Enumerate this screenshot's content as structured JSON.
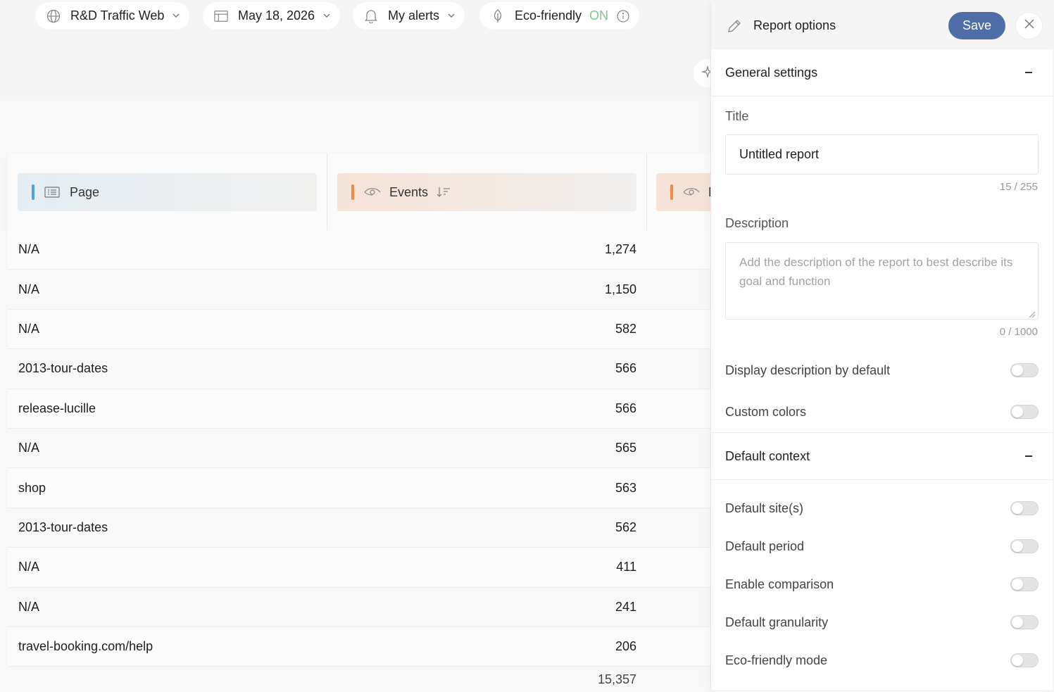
{
  "topbar": {
    "site": {
      "label": "R&D Traffic Web",
      "icon": "globe-icon"
    },
    "date": {
      "label": "May 18, 2026",
      "icon": "calendar-icon"
    },
    "alerts": {
      "label": "My alerts",
      "icon": "bell-icon"
    },
    "eco": {
      "label": "Eco-friendly",
      "status": "ON",
      "status_color": "#7fc88b",
      "icon": "leaf-icon"
    }
  },
  "table": {
    "columns": [
      {
        "label": "Page",
        "icon": "list-icon",
        "accent": "#4aa3e8"
      },
      {
        "label": "Events",
        "icon": "eye-icon",
        "accent": "#f08a4b"
      },
      {
        "label": "F",
        "icon": "eye-icon",
        "accent": "#f08a4b"
      }
    ],
    "rows": [
      {
        "page": "N/A",
        "events": "1,274"
      },
      {
        "page": "N/A",
        "events": "1,150"
      },
      {
        "page": "N/A",
        "events": "582"
      },
      {
        "page": "2013-tour-dates",
        "events": "566"
      },
      {
        "page": "release-lucille",
        "events": "566"
      },
      {
        "page": "N/A",
        "events": "565"
      },
      {
        "page": "shop",
        "events": "563"
      },
      {
        "page": "2013-tour-dates",
        "events": "562"
      },
      {
        "page": "N/A",
        "events": "411"
      },
      {
        "page": "N/A",
        "events": "241"
      },
      {
        "page": "travel-booking.com/help",
        "events": "206"
      }
    ],
    "total": "15,357"
  },
  "panel": {
    "title": "Report options",
    "save_label": "Save",
    "accent": "#4f6ea8",
    "general": {
      "heading": "General settings",
      "title_label": "Title",
      "title_value": "Untitled report",
      "title_counter": "15 / 255",
      "description_label": "Description",
      "description_placeholder": "Add the description of the report to best describe its goal and function",
      "description_counter": "0 / 1000",
      "toggles": [
        {
          "label": "Display description by default",
          "on": false
        },
        {
          "label": "Custom colors",
          "on": false
        }
      ]
    },
    "context": {
      "heading": "Default context",
      "toggles": [
        {
          "label": "Default site(s)",
          "on": false
        },
        {
          "label": "Default period",
          "on": false
        },
        {
          "label": "Enable comparison",
          "on": false
        },
        {
          "label": "Default granularity",
          "on": false
        },
        {
          "label": "Eco-friendly mode",
          "on": false
        }
      ]
    }
  }
}
